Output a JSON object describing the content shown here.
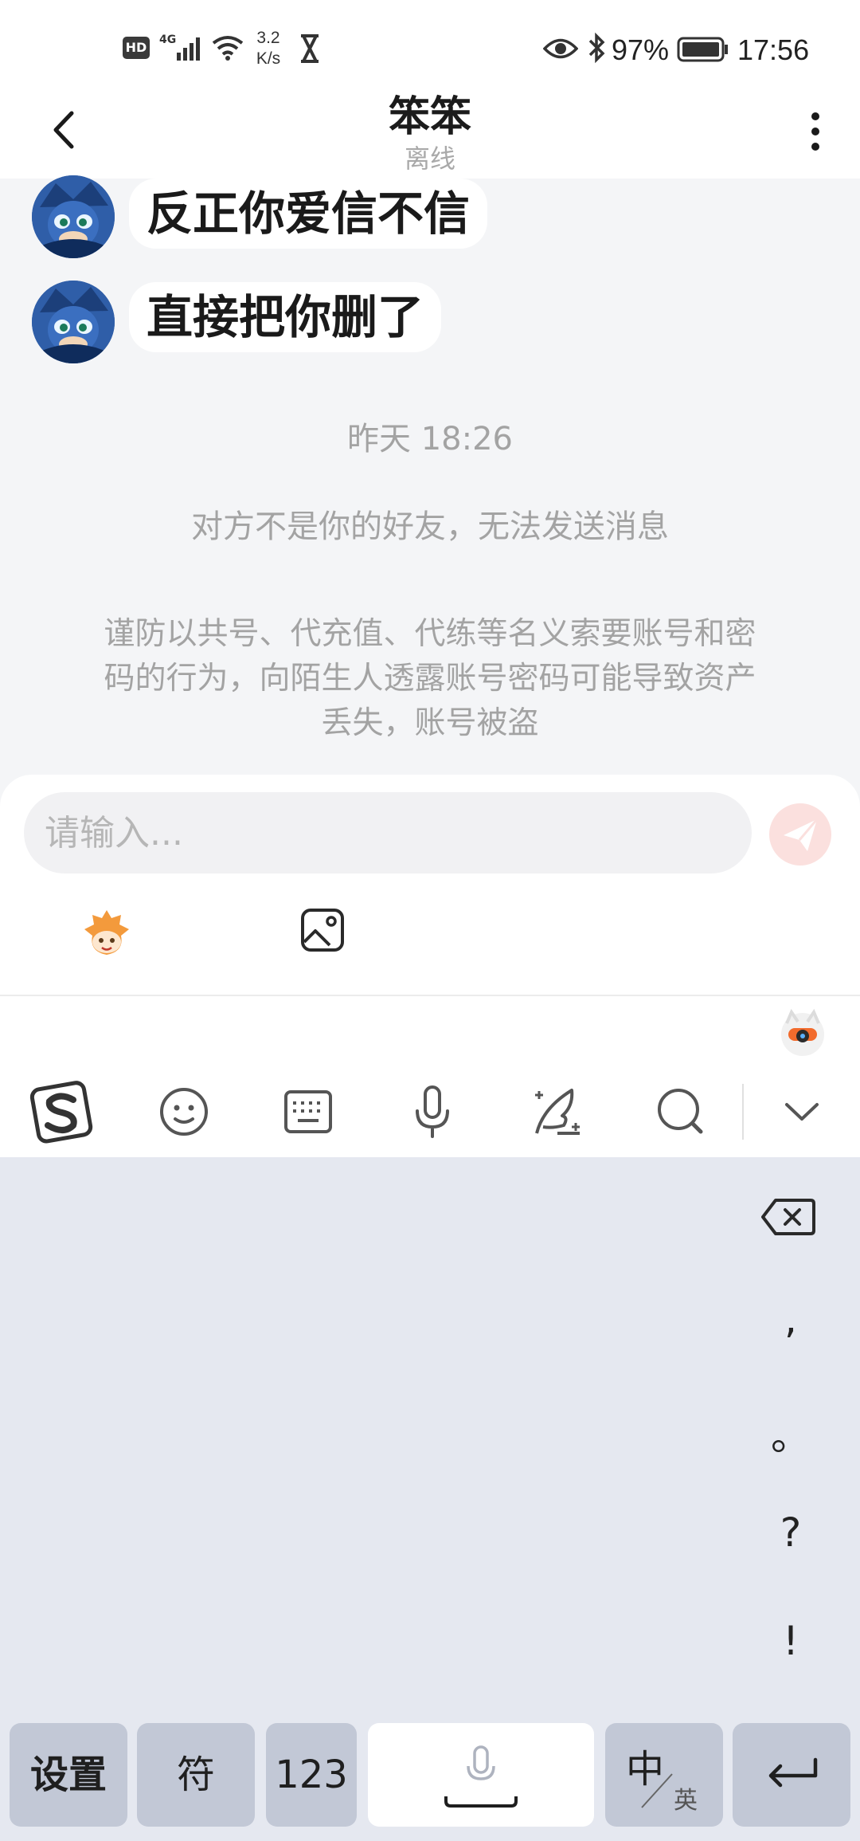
{
  "status_bar": {
    "hd_badge": "HD",
    "network": "4G",
    "speed_value": "3.2",
    "speed_unit": "K/s",
    "battery": "97%",
    "time": "17:56"
  },
  "header": {
    "title": "笨笨",
    "status": "离线"
  },
  "messages": [
    {
      "text": "反正你爱信不信"
    },
    {
      "text": "直接把你删了"
    }
  ],
  "timestamp": "昨天 18:26",
  "system_notice": "对方不是你的好友，无法发送消息",
  "security_warning": {
    "line1": "谨防以共号、代充值、代练等名义索要账号和密",
    "line2": "码的行为，向陌生人透露账号密码可能导致资产",
    "line3": "丢失，账号被盗"
  },
  "input": {
    "placeholder": "请输入..."
  },
  "keyboard": {
    "punctuation": [
      ",",
      "。",
      "?",
      "!"
    ],
    "keys": {
      "settings": "设置",
      "symbols": "符",
      "numbers": "123",
      "lang_main": "中",
      "lang_alt": "英"
    }
  },
  "colors": {
    "accent": "#f26a5e",
    "bubble": "#ffffff",
    "keyboard_bg": "#e5e8f0"
  },
  "icons": {
    "back": "chevron-left-icon",
    "more": "more-vertical-icon",
    "send": "send-icon",
    "image": "image-icon",
    "sticker": "sticker-icon",
    "delete": "backspace-icon",
    "enter": "enter-icon"
  }
}
